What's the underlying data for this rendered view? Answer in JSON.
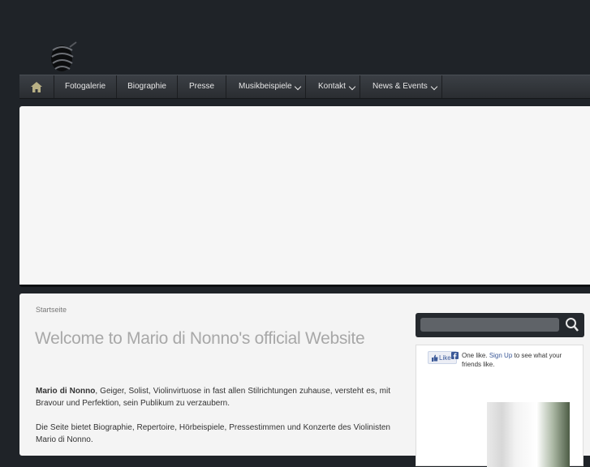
{
  "nav": {
    "items": [
      {
        "label": "Fotogalerie"
      },
      {
        "label": "Biographie"
      },
      {
        "label": "Presse"
      },
      {
        "label": "Musikbeispiele"
      },
      {
        "label": "Kontakt"
      },
      {
        "label": "News & Events"
      }
    ]
  },
  "main": {
    "breadcrumb": "Startseite",
    "title": "Welcome to Mario di Nonno's official Website",
    "intro_name": "Mario di Nonno",
    "intro_rest": ", Geiger, Solist, Violinvirtuose in fast allen Stilrichtungen zuhause, versteht es, mit Bravour und Perfektion, sein Publikum zu verzaubern.",
    "second": "Die Seite bietet Biographie, Repertoire, Hörbeispiele, Pressestimmen und Konzerte des Violinisten Mario di Nonno."
  },
  "sidebar": {
    "search_placeholder": "",
    "facebook": {
      "like_label": "Like",
      "count_text": "One like.",
      "signup_link": "Sign Up",
      "signup_rest": "to see what your friends like."
    }
  },
  "icons": {
    "home": "home-icon",
    "search": "search-icon",
    "facebook": "facebook-icon",
    "thumbs": "thumbs-up-icon",
    "chevron": "chevron-down-icon"
  },
  "colors": {
    "background": "#1f2328",
    "navbar": "#2f3237",
    "title": "#a8a8a8",
    "link": "#3b5998"
  }
}
